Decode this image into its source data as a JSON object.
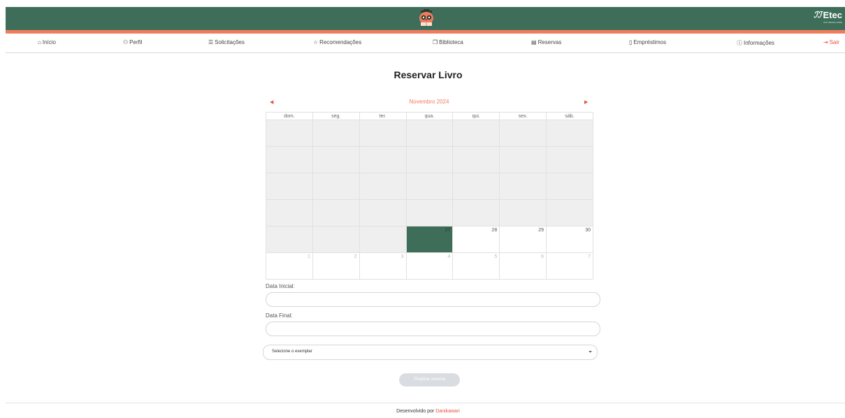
{
  "header": {
    "logo_brand": "Etec",
    "logo_sub": "Prof. Marcos Uchôa"
  },
  "nav": {
    "items": [
      {
        "label": "Início",
        "icon": "home-icon"
      },
      {
        "label": "Perfil",
        "icon": "user-icon"
      },
      {
        "label": "Solicitações",
        "icon": "list-icon"
      },
      {
        "label": "Recomendações",
        "icon": "star-icon"
      },
      {
        "label": "Biblioteca",
        "icon": "book-icon"
      },
      {
        "label": "Reservas",
        "icon": "calendar-icon"
      },
      {
        "label": "Empréstimos",
        "icon": "bookmark-icon"
      },
      {
        "label": "Informações",
        "icon": "info-icon"
      },
      {
        "label": "Sair",
        "icon": "logout-icon"
      }
    ]
  },
  "page": {
    "title": "Reservar Livro"
  },
  "calendar": {
    "month_label": "Novembro 2024",
    "weekdays": [
      "dom.",
      "seg.",
      "ter.",
      "qua.",
      "qui.",
      "sex.",
      "sáb."
    ],
    "today": "27",
    "weeks": [
      [
        "",
        "",
        "",
        "",
        "",
        "",
        ""
      ],
      [
        "",
        "",
        "",
        "",
        "",
        "",
        ""
      ],
      [
        "",
        "",
        "",
        "",
        "",
        "",
        ""
      ],
      [
        "",
        "",
        "",
        "",
        "",
        "",
        ""
      ],
      [
        "",
        "",
        "",
        "27",
        "28",
        "29",
        "30"
      ],
      [
        "1",
        "2",
        "3",
        "4",
        "5",
        "6",
        "7"
      ]
    ]
  },
  "form": {
    "start_label": "Data Inicial:",
    "start_value": "",
    "end_label": "Data Final:",
    "end_value": "",
    "select_value": "Selecione o exemplar",
    "submit_label": "Finalizar reserva"
  },
  "footer": {
    "text": "Desenvolvido por",
    "author": "Danikawari"
  },
  "colors": {
    "primary": "#3e6e5a",
    "accent": "#f07c5c",
    "logout": "#e8533b"
  }
}
